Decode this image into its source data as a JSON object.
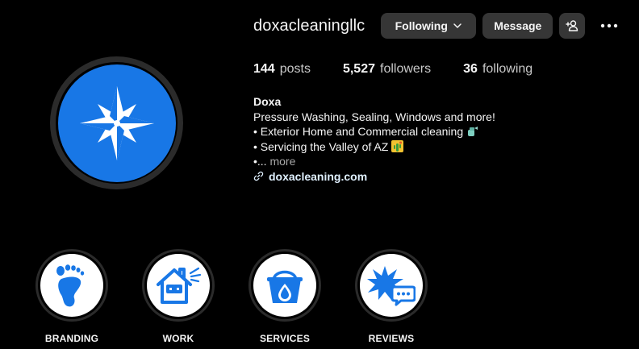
{
  "colors": {
    "background": "#000000",
    "brand_blue": "#1877e6",
    "button_bg": "#363636",
    "link": "#e0f1ff"
  },
  "profile": {
    "username": "doxacleaningllc",
    "following_button_label": "Following",
    "message_button_label": "Message",
    "add_user_icon": "person-plus-icon",
    "more_icon": "ellipsis-icon",
    "avatar_icon": "compass-star-icon"
  },
  "stats": {
    "posts": {
      "value": "144",
      "label": "posts"
    },
    "followers": {
      "value": "5,527",
      "label": "followers"
    },
    "following": {
      "value": "36",
      "label": "following"
    }
  },
  "bio": {
    "name": "Doxa",
    "line1": "Pressure Washing, Sealing, Windows and more!",
    "line2": "• Exterior Home and Commercial cleaning",
    "line2_emoji_icon": "spray-bottle-icon",
    "line3": "• Servicing the Valley of AZ",
    "line3_emoji_icon": "desert-cactus-icon",
    "line4_prefix": "•...",
    "more_label": "more",
    "link_icon": "link-icon",
    "website": "doxacleaning.com"
  },
  "highlights": [
    {
      "label": "BRANDING",
      "icon": "footprint-icon"
    },
    {
      "label": "WORK",
      "icon": "house-spray-icon"
    },
    {
      "label": "SERVICES",
      "icon": "bucket-drop-icon"
    },
    {
      "label": "REVIEWS",
      "icon": "star-burst-chat-icon"
    }
  ]
}
